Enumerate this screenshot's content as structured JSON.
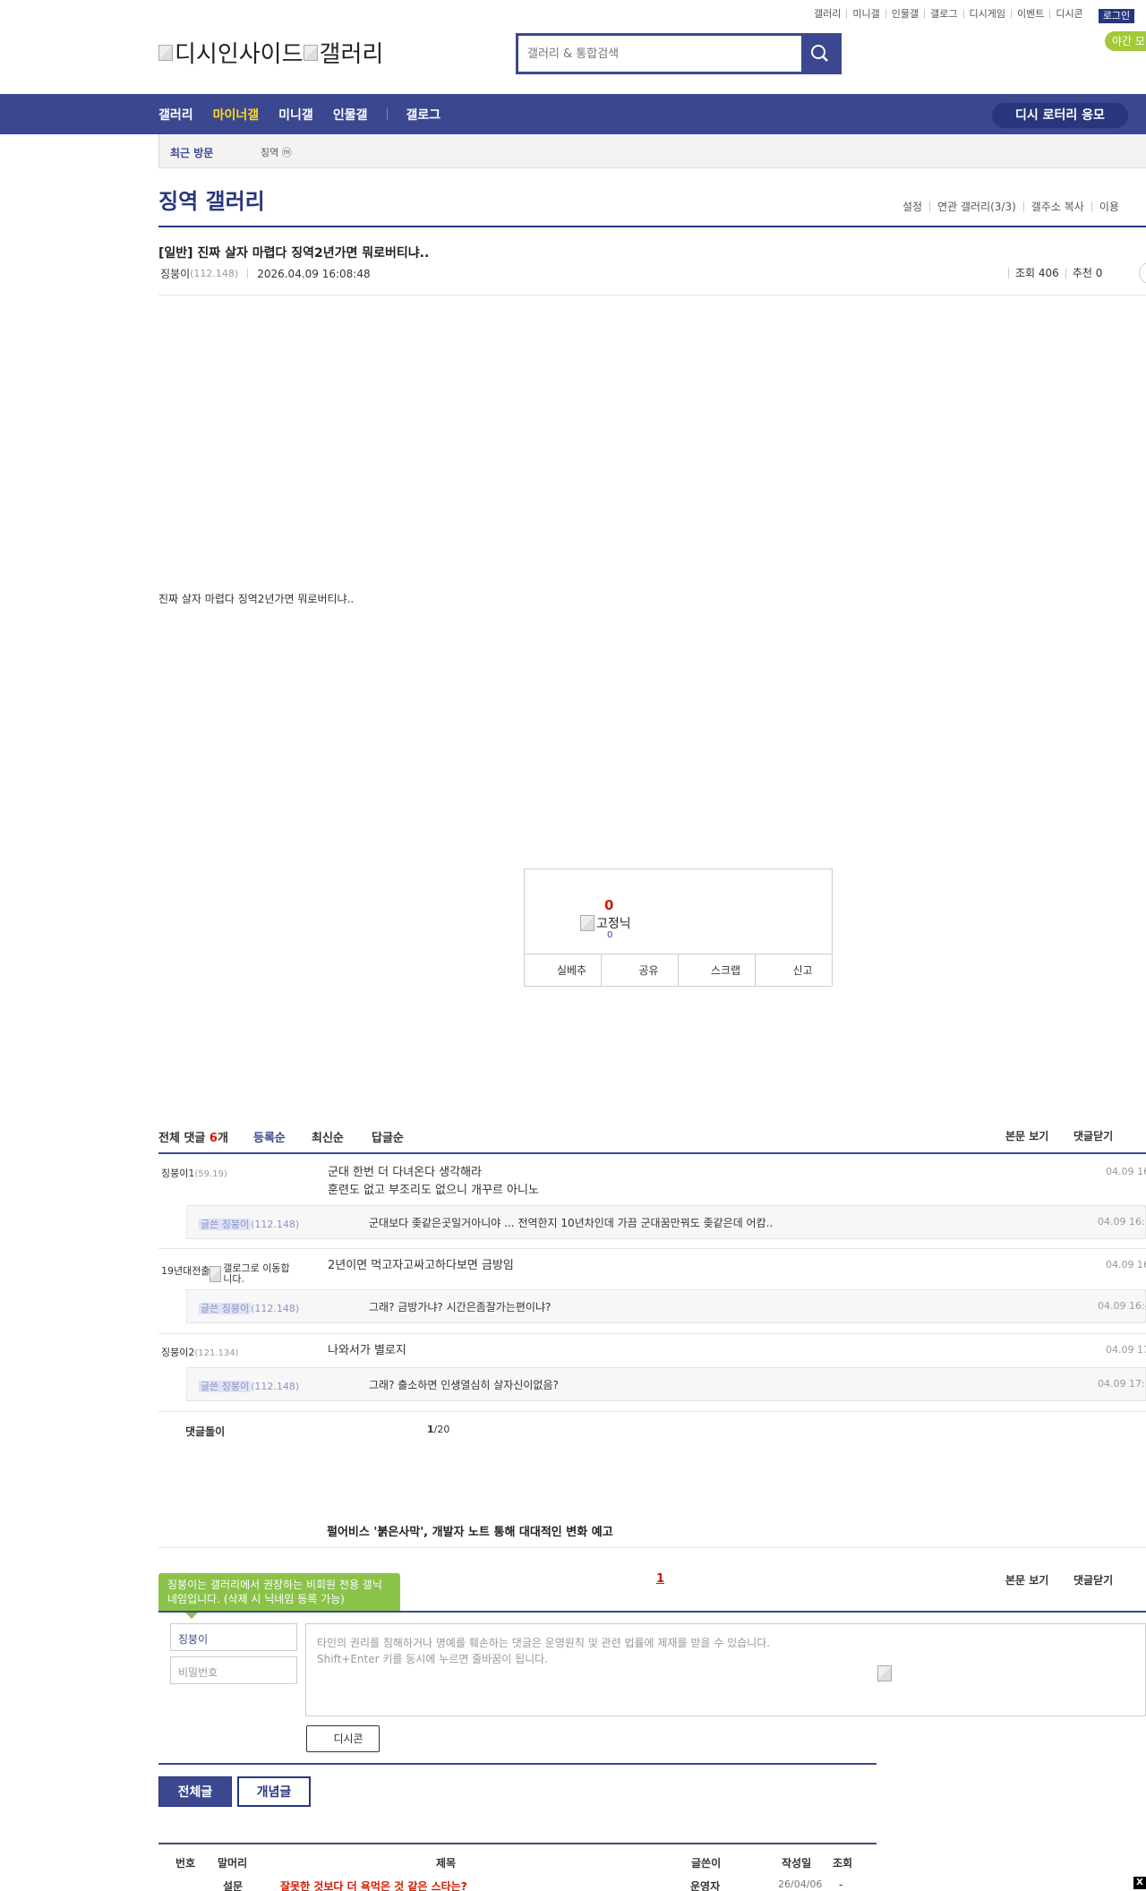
{
  "header": {
    "top_menu": [
      "갤러리",
      "미니갤",
      "인물갤",
      "갤로그",
      "디시게임",
      "이벤트",
      "디시콘"
    ],
    "login_label": "로그인",
    "night_label": "야간 모",
    "logo_alt_1": "디시인사이드",
    "logo_alt_2": "갤러리",
    "search_placeholder": "갤러리 & 통합검색"
  },
  "gnb": {
    "items": [
      "갤러리",
      "마이너갤",
      "미니갤",
      "인물갤",
      "갤로그"
    ],
    "active": "마이너갤",
    "lotto_label": "디시 로터리 응모"
  },
  "recent": {
    "label": "최근 방문",
    "gallery": "징역 ⓜ"
  },
  "gallery": {
    "title": "징역 갤러리",
    "options": [
      "설정",
      "연관 갤러리(3/3)",
      "갤주소 복사",
      "이용"
    ]
  },
  "post": {
    "title": "[일반] 진짜 살자 마렵다 징역2년가면 뭐로버티냐..",
    "author": "징붕이",
    "author_ip": "(112.148)",
    "date": "2026.04.09 16:08:48",
    "views": "조회 406",
    "recommends": "추천 0",
    "body": "진짜 살자 마렵다 징역2년가면 뭐로버티냐.."
  },
  "recommend": {
    "count": "0",
    "fixed_nick_alt": "고정닉",
    "fixed_count": "0",
    "buttons": [
      "실베추",
      "공유",
      "스크랩",
      "신고"
    ]
  },
  "comments": {
    "total_label": "전체 댓글",
    "total_count": "6",
    "total_unit": "개",
    "sort_options": [
      "등록순",
      "최신순",
      "답글순"
    ],
    "right_options": [
      "본문 보기",
      "댓글닫기"
    ],
    "items": [
      {
        "nick": "징붕이1",
        "ip": "(59.19)",
        "line1": "군대 한번 더 다녀온다 생각해라",
        "line2": "훈련도 없고 부조리도 없으니 개꾸르 아니노",
        "date": "04.09 16",
        "reply": {
          "badge": "글쓴 징붕이",
          "ip": "(112.148)",
          "text": "군대보다 좆같은곳일거아니야 ... 전역한지 10년차인데 가끔 군대꿈만꿔도 좆같은데 어캄..",
          "date": "04.09 16:1"
        }
      },
      {
        "nick": "19년대전출",
        "nick_img_alt": "갤로그로 이동합니다.",
        "line1": "2년이면 먹고자고싸고하다보면 금방임",
        "date": "04.09 16",
        "reply": {
          "badge": "글쓴 징붕이",
          "ip": "(112.148)",
          "text": "그래? 금방가냐? 시간은좀잘가는편이냐?",
          "date": "04.09 16:4"
        }
      },
      {
        "nick": "징붕이2",
        "ip": "(121.134)",
        "line1": "나와서가 별로지",
        "date": "04.09 17",
        "reply": {
          "badge": "글쓴 징붕이",
          "ip": "(112.148)",
          "text": "그래? 출소하면 인생열심히 살자신이없음?",
          "date": "04.09 17:1"
        }
      }
    ],
    "pager_label": "댓글돌이",
    "page_current": "1",
    "page_total": "/20"
  },
  "news": {
    "headline": "펄어비스 '붉은사막', 개발자 노트 통해 대대적인 변화 예고"
  },
  "write": {
    "tooltip": "징붕이는 갤러리에서 권장하는 비회원 전용 갤닉네임입니다. (삭제 시 닉네임 등록 가능)",
    "page": "1",
    "right_options": [
      "본문 보기",
      "댓글닫기"
    ],
    "nick_value": "징붕이",
    "pw_placeholder": "비밀번호",
    "textarea_line1": "타인의 권리를 침해하거나 명예를 훼손하는 댓글은 운영원칙 및 관련 법률에 제재를 받을 수 있습니다.",
    "textarea_line2": "Shift+Enter 키를 동시에 누르면 줄바꿈이 됩니다.",
    "dccon_label": "디시콘"
  },
  "list": {
    "tab_all": "전체글",
    "tab_concept": "개념글",
    "columns": [
      "번호",
      "말머리",
      "제목",
      "글쓴이",
      "작성일",
      "조회"
    ],
    "row": {
      "head": "설문",
      "title": "잘못한 것보다 더 욕먹은 것 같은 스타는?",
      "author": "운영자",
      "date": "26/04/06",
      "views": "-"
    }
  },
  "colors": {
    "brand": "#3b4890",
    "brand_dark": "#29367c",
    "accent_red": "#d31900",
    "active_nav": "#ffd91c",
    "tooltip_green": "#8bc34a"
  }
}
